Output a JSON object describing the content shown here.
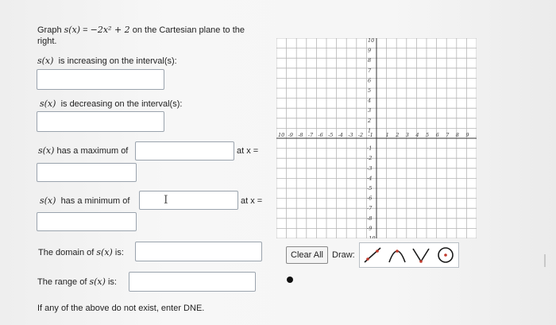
{
  "question": {
    "prefix": "Graph ",
    "func_lhs": "s(x)",
    "equals": " = ",
    "func_rhs": "−2x² + 2",
    "suffix": " on the Cartesian plane to the",
    "line2": "right."
  },
  "prompts": {
    "increasing": "is increasing on the interval(s):",
    "decreasing": "is decreasing on the interval(s):",
    "maximum": "has a maximum of",
    "minimum": "has a minimum of",
    "at_x": "at x =",
    "domain_pre": "The domain of",
    "domain_post": "is:",
    "range_pre": "The range of",
    "range_post": "is:",
    "dne_note": "If any of the above do not exist, enter DNE.",
    "func_name": "s(x)"
  },
  "inputs": {
    "increasing": "",
    "decreasing": "",
    "maximum_value": "",
    "maximum_x": "",
    "minimum_value": "",
    "minimum_x": "",
    "domain": "",
    "range": ""
  },
  "graph": {
    "x_ticks": [
      "10",
      "9",
      "8",
      "7",
      "6",
      "5",
      "4",
      "3",
      "2",
      "1",
      "1",
      "2",
      "3",
      "4",
      "5",
      "6",
      "7",
      "8",
      "9",
      "10"
    ],
    "y_ticks_pos": [
      "10",
      "9",
      "8",
      "7",
      "6",
      "5",
      "4",
      "3",
      "2",
      "1"
    ],
    "y_ticks_neg": [
      "1",
      "2",
      "3",
      "4",
      "5",
      "6",
      "7",
      "8",
      "9",
      "10"
    ]
  },
  "controls": {
    "clear_all": "Clear All",
    "draw_label": "Draw:"
  },
  "tool_icons": [
    "line-tool-icon",
    "parabola-up-tool-icon",
    "vee-tool-icon",
    "circle-tool-icon"
  ]
}
